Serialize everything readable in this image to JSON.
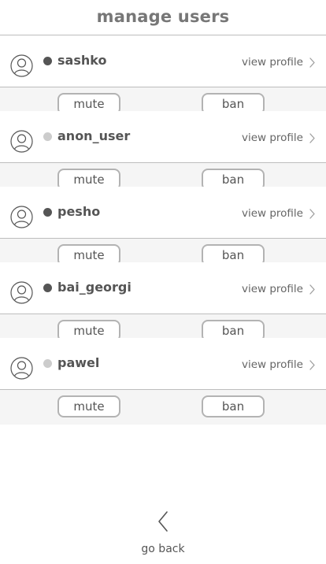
{
  "header": {
    "title": "manage users"
  },
  "users": [
    {
      "name": "sashko",
      "status": "online",
      "view_profile_label": "view profile",
      "mute_label": "mute",
      "ban_label": "ban"
    },
    {
      "name": "anon_user",
      "status": "offline",
      "view_profile_label": "view profile",
      "mute_label": "mute",
      "ban_label": "ban"
    },
    {
      "name": "pesho",
      "status": "online",
      "view_profile_label": "view profile",
      "mute_label": "mute",
      "ban_label": "ban"
    },
    {
      "name": "bai_georgi",
      "status": "online",
      "view_profile_label": "view profile",
      "mute_label": "mute",
      "ban_label": "ban"
    },
    {
      "name": "pawel",
      "status": "offline",
      "view_profile_label": "view profile",
      "mute_label": "mute",
      "ban_label": "ban"
    }
  ],
  "footer": {
    "back_label": "go back",
    "back_icon": "chevron-left-icon"
  },
  "icons": {
    "avatar": "user-avatar-icon",
    "view_profile": "chevron-right-icon"
  },
  "colors": {
    "text": "#555555",
    "online": "#555555",
    "offline": "#cccccc",
    "divider": "#bdbdbd",
    "action_bg": "#f5f5f5",
    "button_border": "#b3b3b3"
  }
}
